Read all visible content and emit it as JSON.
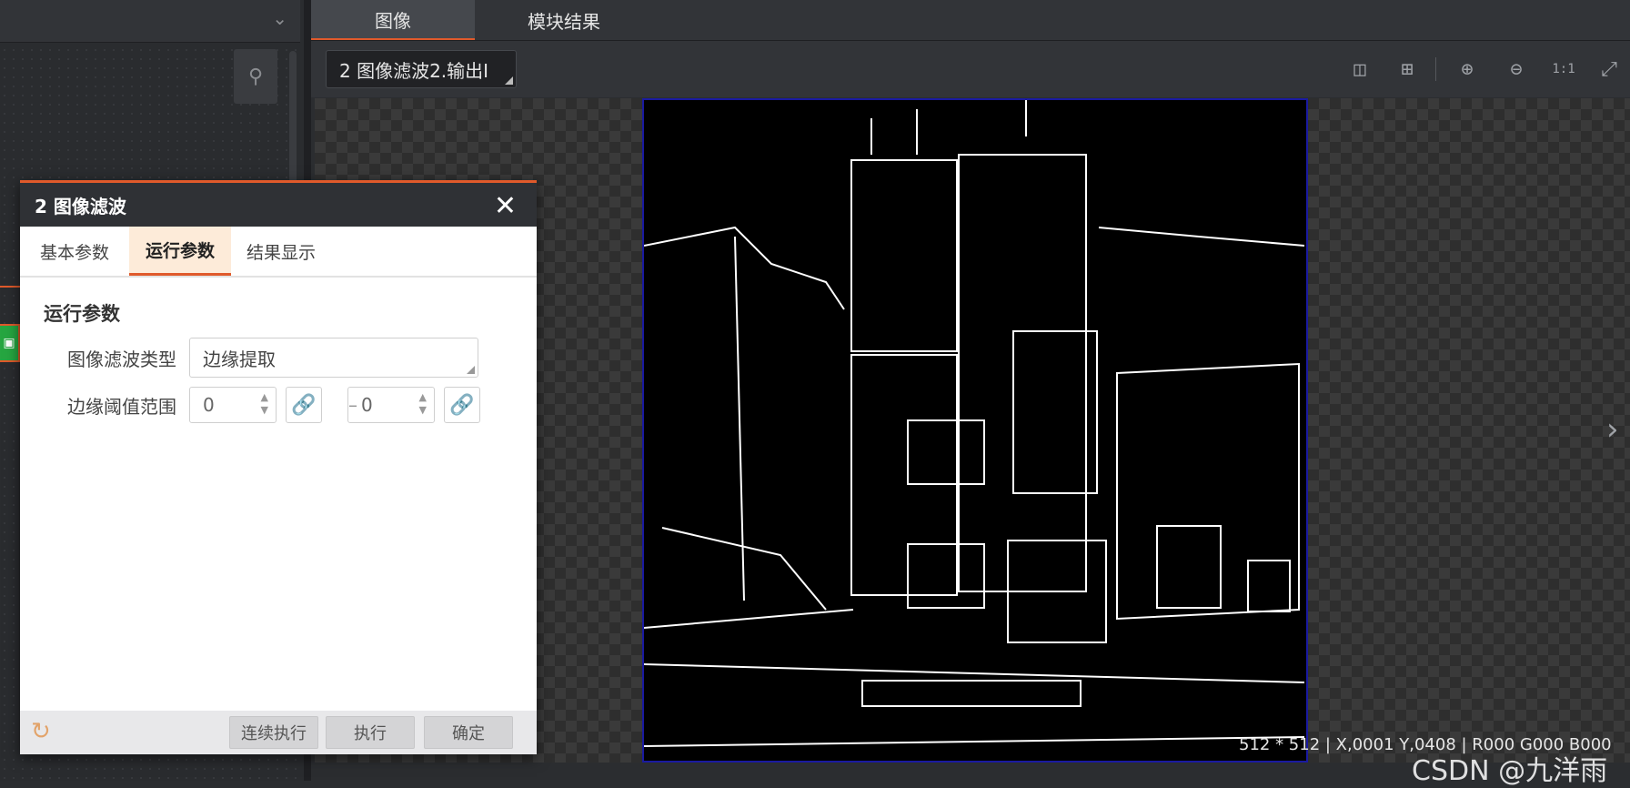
{
  "top_tabs": [
    "图像",
    "模块结果"
  ],
  "image_source": "2 图像滤波2.输出I",
  "toolbar_icons": [
    "layout-split-icon",
    "layout-grid-icon",
    "zoom-in-icon",
    "zoom-out-icon",
    "actual-size-icon",
    "fit-screen-icon"
  ],
  "status": "512 * 512 | X,0001 Y,0408 | R000 G000 B000",
  "watermark": "CSDN @九洋雨",
  "dialog": {
    "title": "2 图像滤波",
    "tabs": [
      "基本参数",
      "运行参数",
      "结果显示"
    ],
    "active_tab": "运行参数",
    "section_title": "运行参数",
    "filter_type_label": "图像滤波类型",
    "filter_type_value": "边缘提取",
    "threshold_label": "边缘阈值范围",
    "threshold_min": "0",
    "threshold_max": "0",
    "range_separator": "–",
    "buttons": [
      "连续执行",
      "执行",
      "确定"
    ]
  },
  "colors": {
    "accent": "#e05a2b",
    "image_border": "#1a1aa0"
  }
}
